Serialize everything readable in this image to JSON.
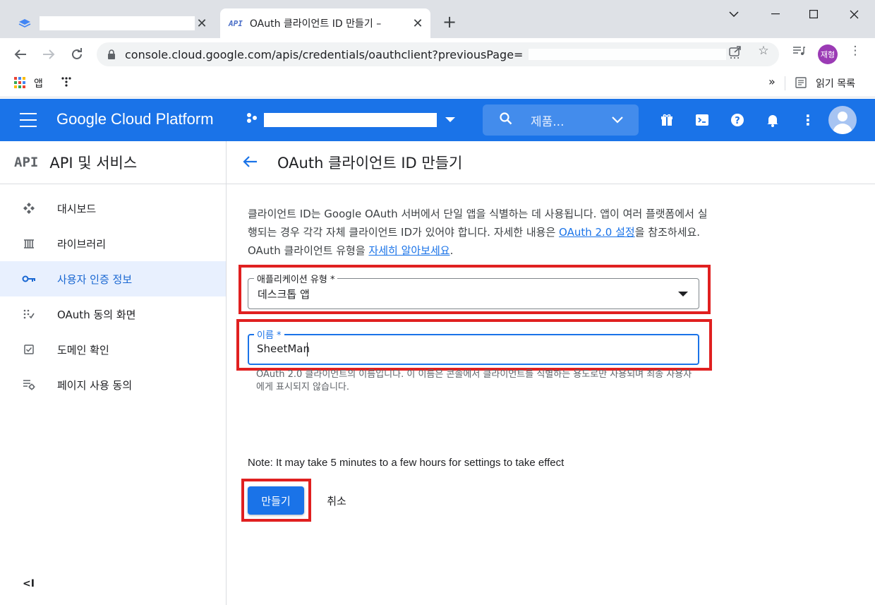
{
  "browser": {
    "tab2_title": "OAuth 클라이언트 ID 만들기 – ",
    "tab2_favicon": "API",
    "new_tab_label": "+",
    "url": "console.cloud.google.com/apis/credentials/oauthclient?previousPage=",
    "url_ellipsis": "...",
    "profile_label": "재형"
  },
  "bookmarks": {
    "apps_label": "앱",
    "more": "»",
    "reading_list": "읽기 목록"
  },
  "header": {
    "title": "Google Cloud Platform",
    "search_placeholder": "제품..."
  },
  "sidebar": {
    "logo": "API",
    "title": "API 및 서비스",
    "items": [
      {
        "label": "대시보드",
        "icon": "dashboard-icon"
      },
      {
        "label": "라이브러리",
        "icon": "library-icon"
      },
      {
        "label": "사용자 인증 정보",
        "icon": "key-icon",
        "active": true
      },
      {
        "label": "OAuth 동의 화면",
        "icon": "consent-icon"
      },
      {
        "label": "도메인 확인",
        "icon": "checkbox-icon"
      },
      {
        "label": "페이지 사용 동의",
        "icon": "settings-list-icon"
      }
    ],
    "collapse": "<I"
  },
  "main": {
    "title": "OAuth 클라이언트 ID 만들기",
    "desc_part1": "클라이언트 ID는 Google OAuth 서버에서 단일 앱을 식별하는 데 사용됩니다. 앱이 여러 플랫폼에서 실행되는 경우 각각 자체 클라이언트 ID가 있어야 합니다. 자세한 내용은 ",
    "desc_link1": "OAuth 2.0 설정",
    "desc_part2": "을 참조하세요. OAuth 클라이언트 유형을 ",
    "desc_link2": "자세히 알아보세요",
    "desc_part3": ".",
    "app_type_label": "애플리케이션 유형 *",
    "app_type_value": "데스크톱 앱",
    "name_label": "이름 *",
    "name_value": "SheetMan",
    "name_helper": "OAuth 2.0 클라이언트의 이름입니다. 이 이름은 콘솔에서 클라이언트를 식별하는 용도로만 사용되며 최종 사용자에게 표시되지 않습니다.",
    "note": "Note: It may take 5 minutes to a few hours for settings to take effect",
    "create_label": "만들기",
    "cancel_label": "취소"
  },
  "colors": {
    "brand_blue": "#1a73e8",
    "highlight_red": "#e02020"
  }
}
